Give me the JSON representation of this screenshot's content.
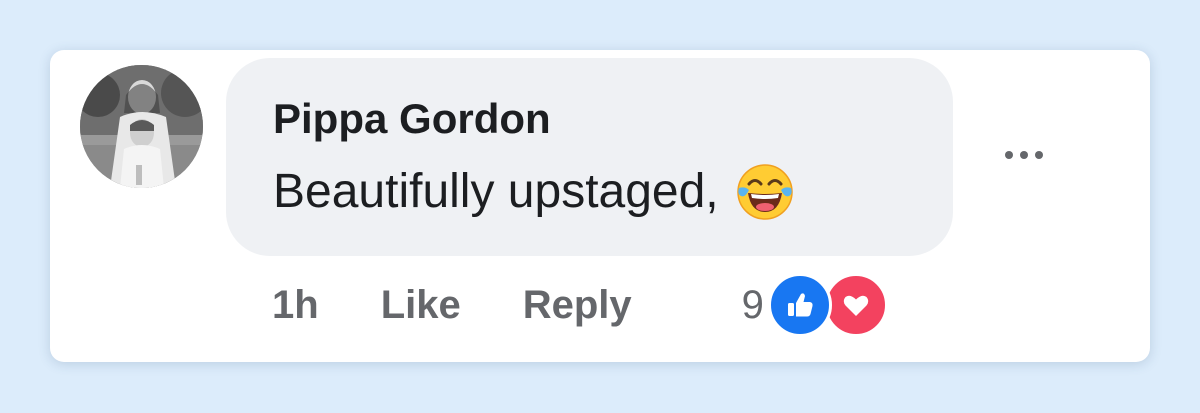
{
  "comment": {
    "author": "Pippa Gordon",
    "text": "Beautifully upstaged,",
    "emoji": "face-with-tears-of-joy-emoji",
    "timestamp": "1h",
    "like_label": "Like",
    "reply_label": "Reply",
    "reaction_count": "9",
    "reactions": [
      "like-icon",
      "love-icon"
    ]
  },
  "colors": {
    "background": "#dcecfb",
    "bubble": "#eff1f4",
    "like": "#1877f2",
    "love": "#f3425f",
    "muted_text": "#65676b"
  }
}
